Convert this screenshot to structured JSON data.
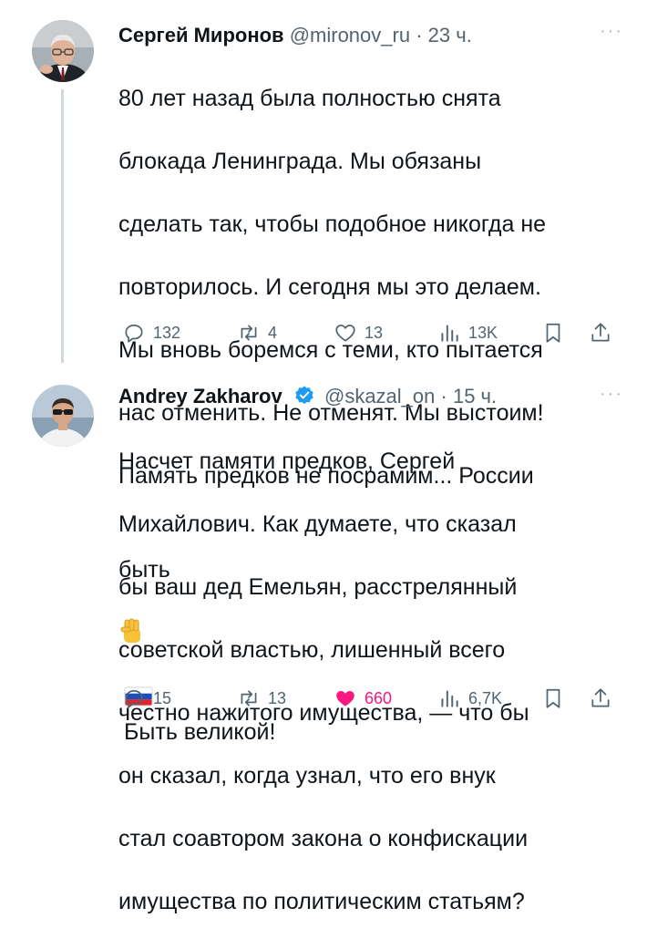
{
  "tweets": [
    {
      "author": {
        "name": "Сергей Миронов",
        "handle": "@mironov_ru",
        "verified": false
      },
      "time": "23 ч.",
      "text_lines": [
        "80 лет назад была полностью снята",
        "блокада Ленинграда. Мы обязаны",
        "сделать так, чтобы подобное никогда не",
        "повторилось. И сегодня мы это делаем.",
        "Мы вновь боремся с теми, кто пытается",
        "нас отменить. Не отменят. Мы выстоим!",
        "Память предков не посрамим... России"
      ],
      "last_line": {
        "before": "быть",
        "after": "Быть великой!"
      },
      "emojis": [
        "raised-fist-icon",
        "russia-flag-icon"
      ],
      "stats": {
        "replies": "132",
        "reposts": "4",
        "likes": "13",
        "views": "13K"
      }
    },
    {
      "author": {
        "name": "Andrey Zakharov",
        "handle": "@skazal_on",
        "verified": true
      },
      "time": "15 ч.",
      "text_lines": [
        "Насчет памяти предков, Сергей",
        "Михайлович. Как думаете, что сказал",
        "бы ваш дед Емельян, расстрелянный",
        "советской властью, лишенный всего",
        "честно нажитого имущества, — что бы",
        "он сказал, когда узнал, что его внук",
        "стал соавтором закона о конфискации",
        "имущества по политическим статьям?"
      ],
      "stats": {
        "replies": "15",
        "reposts": "13",
        "likes": "660",
        "views": "6,7K"
      }
    }
  ],
  "colors": {
    "text": "#0f1419",
    "secondary": "#536471",
    "like_active": "#f91880",
    "verified": "#1d9bf0",
    "thread_line": "#cfd9de"
  }
}
